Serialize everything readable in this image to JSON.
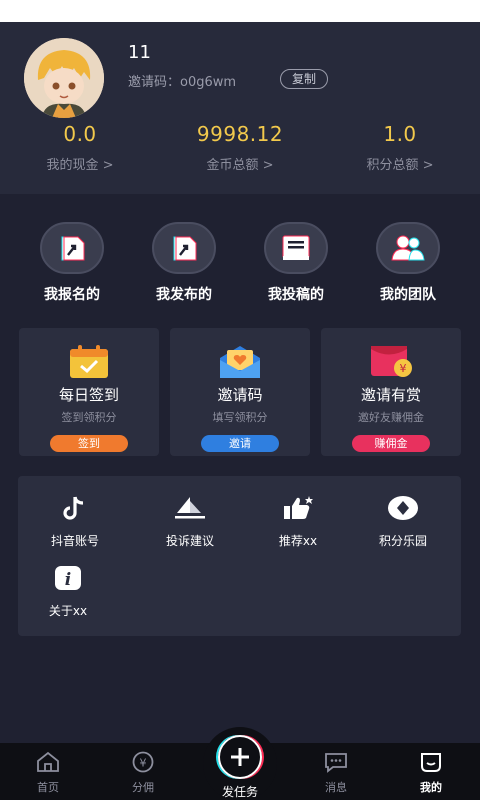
{
  "profile": {
    "nickname": "11",
    "invite_label": "邀请码：o0g6wm",
    "copy_button": "复制"
  },
  "stats": [
    {
      "value": "0.0",
      "label": "我的现金 >"
    },
    {
      "value": "9998.12",
      "label": "金币总额 >"
    },
    {
      "value": "1.0",
      "label": "积分总额 >"
    }
  ],
  "quick_actions": [
    {
      "label": "我报名的",
      "icon": "signup-arrow-icon"
    },
    {
      "label": "我发布的",
      "icon": "publish-arrow-icon"
    },
    {
      "label": "我投稿的",
      "icon": "document-icon"
    },
    {
      "label": "我的团队",
      "icon": "team-icon"
    }
  ],
  "cards": [
    {
      "title": "每日签到",
      "subtitle": "签到领积分",
      "button": "签到",
      "button_color": "#f07a2e",
      "icon": "calendar-check-icon"
    },
    {
      "title": "邀请码",
      "subtitle": "填写领积分",
      "button": "邀请",
      "button_color": "#2f7fe0",
      "icon": "envelope-heart-icon"
    },
    {
      "title": "邀请有赏",
      "subtitle": "邀好友赚佣金",
      "button": "赚佣金",
      "button_color": "#e8315e",
      "icon": "red-envelope-icon"
    }
  ],
  "tools": [
    {
      "label": "抖音账号",
      "icon": "tiktok-icon"
    },
    {
      "label": "投诉建议",
      "icon": "paper-boat-icon"
    },
    {
      "label": "推荐xx",
      "icon": "thumbs-up-icon"
    },
    {
      "label": "积分乐园",
      "icon": "diamond-icon"
    },
    {
      "label": "关于xx",
      "icon": "info-icon"
    }
  ],
  "tabbar": {
    "home": "首页",
    "commission": "分佣",
    "post_task": "发任务",
    "messages": "消息",
    "mine": "我的"
  },
  "colors": {
    "accent_gold": "#f2c94c",
    "background": "#1f2131",
    "panel": "#2b2e3f",
    "tiktok_cyan": "#25e0ea",
    "tiktok_red": "#ff2c55"
  }
}
